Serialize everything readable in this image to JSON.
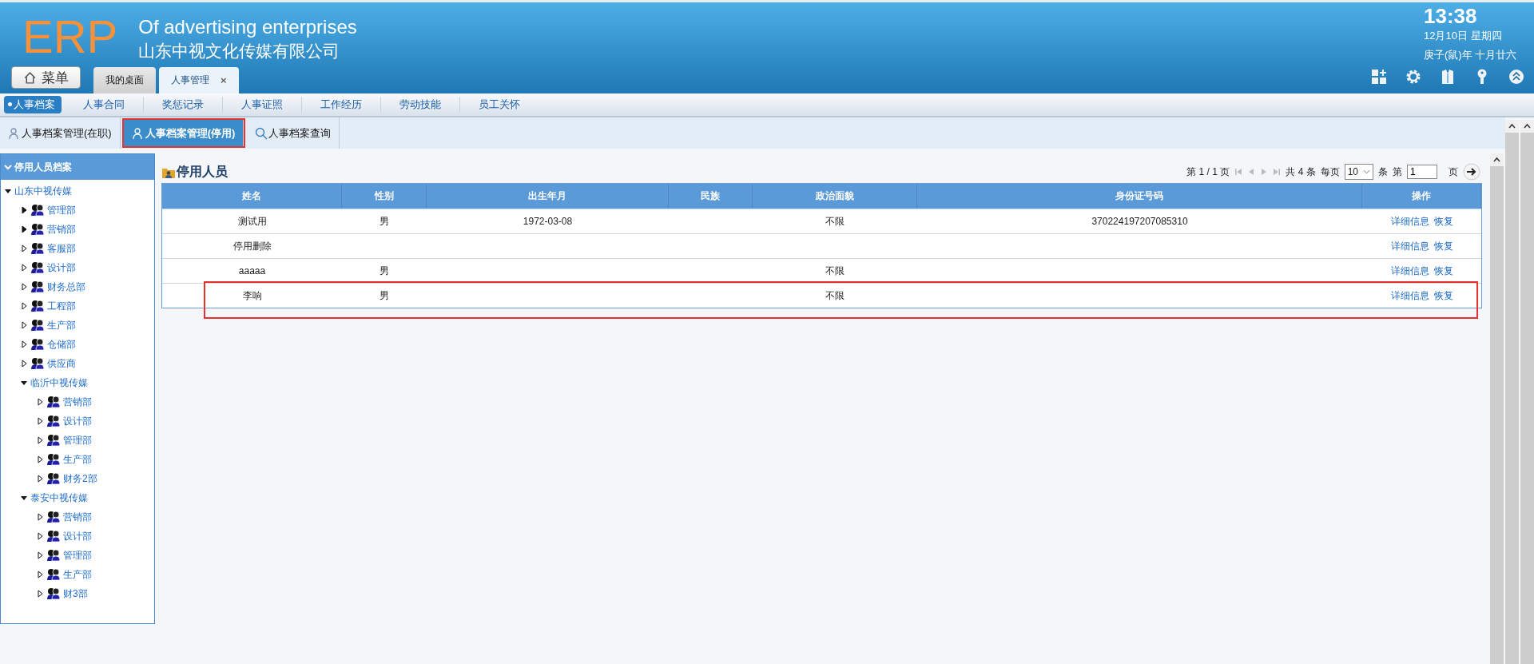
{
  "header": {
    "logo": "ERP",
    "title": "Of advertising enterprises",
    "company": "山东中视文化传媒有限公司",
    "menu_button": "菜单",
    "tabs": [
      {
        "label": "我的桌面",
        "selected": false,
        "closable": false
      },
      {
        "label": "人事管理",
        "selected": true,
        "closable": true,
        "close": "×"
      }
    ],
    "clock": {
      "time": "13:38",
      "date": "12月10日 星期四",
      "lunar": "庚子(鼠)年 十月廿六"
    }
  },
  "nav": [
    {
      "label": "人事档案",
      "selected": true
    },
    {
      "label": "人事合同",
      "selected": false
    },
    {
      "label": "奖惩记录",
      "selected": false
    },
    {
      "label": "人事证照",
      "selected": false
    },
    {
      "label": "工作经历",
      "selected": false
    },
    {
      "label": "劳动技能",
      "selected": false
    },
    {
      "label": "员工关怀",
      "selected": false
    }
  ],
  "subtabs": [
    {
      "label": "人事档案管理(在职)",
      "kind": "person",
      "selected": false,
      "highlighted": false
    },
    {
      "label": "人事档案管理(停用)",
      "kind": "person",
      "selected": true,
      "highlighted": true
    },
    {
      "label": "人事档案查询",
      "kind": "search",
      "selected": false,
      "highlighted": false
    }
  ],
  "sidebar": {
    "title": "停用人员档案",
    "tree": [
      {
        "label": "山东中视传媒",
        "kind": "company",
        "expanded": true,
        "children": [
          {
            "label": "管理部",
            "kind": "department",
            "expanded": false,
            "has_children": true
          },
          {
            "label": "营销部",
            "kind": "department",
            "expanded": false,
            "has_children": true
          },
          {
            "label": "客服部",
            "kind": "department",
            "expanded": false,
            "has_children": false
          },
          {
            "label": "设计部",
            "kind": "department",
            "expanded": false,
            "has_children": false
          },
          {
            "label": "财务总部",
            "kind": "department",
            "expanded": false,
            "has_children": false
          },
          {
            "label": "工程部",
            "kind": "department",
            "expanded": false,
            "has_children": false
          },
          {
            "label": "生产部",
            "kind": "department",
            "expanded": false,
            "has_children": false
          },
          {
            "label": "仓储部",
            "kind": "department",
            "expanded": false,
            "has_children": false
          },
          {
            "label": "供应商",
            "kind": "department",
            "expanded": false,
            "has_children": false
          },
          {
            "label": "临沂中视传媒",
            "kind": "company",
            "expanded": true,
            "children": [
              {
                "label": "营销部",
                "kind": "department",
                "expanded": false,
                "has_children": false
              },
              {
                "label": "设计部",
                "kind": "department",
                "expanded": false,
                "has_children": false
              },
              {
                "label": "管理部",
                "kind": "department",
                "expanded": false,
                "has_children": false
              },
              {
                "label": "生产部",
                "kind": "department",
                "expanded": false,
                "has_children": false
              },
              {
                "label": "财务2部",
                "kind": "department",
                "expanded": false,
                "has_children": false
              }
            ]
          },
          {
            "label": "泰安中视传媒",
            "kind": "company",
            "expanded": true,
            "children": [
              {
                "label": "营销部",
                "kind": "department",
                "expanded": false,
                "has_children": false
              },
              {
                "label": "设计部",
                "kind": "department",
                "expanded": false,
                "has_children": false
              },
              {
                "label": "管理部",
                "kind": "department",
                "expanded": false,
                "has_children": false
              },
              {
                "label": "生产部",
                "kind": "department",
                "expanded": false,
                "has_children": false
              },
              {
                "label": "财3部",
                "kind": "department",
                "expanded": false,
                "has_children": false
              }
            ]
          }
        ]
      }
    ]
  },
  "main": {
    "title": "停用人员",
    "pager": {
      "page": "第 1 / 1 页",
      "total": "共 4 条",
      "per_page_label": "每页",
      "per_page": "10",
      "unit": "条",
      "goto_label": "第",
      "goto_value": "1",
      "goto_unit": "页"
    },
    "table": {
      "columns": [
        "姓名",
        "性别",
        "出生年月",
        "民族",
        "政治面貌",
        "身份证号码",
        "操作"
      ],
      "rows": [
        {
          "cells": [
            "测试用",
            "男",
            "1972-03-08",
            "",
            "不限",
            "370224197207085310"
          ],
          "actions": [
            "详细信息",
            "恢复"
          ],
          "highlighted": false
        },
        {
          "cells": [
            "停用删除",
            "",
            "",
            "",
            "",
            ""
          ],
          "actions": [
            "详细信息",
            "恢复"
          ],
          "highlighted": false
        },
        {
          "cells": [
            "aaaaa",
            "男",
            "",
            "",
            "不限",
            ""
          ],
          "actions": [
            "详细信息",
            "恢复"
          ],
          "highlighted": false
        },
        {
          "cells": [
            "李响",
            "男",
            "",
            "",
            "不限",
            ""
          ],
          "actions": [
            "详细信息",
            "恢复"
          ],
          "highlighted": true
        }
      ]
    }
  }
}
